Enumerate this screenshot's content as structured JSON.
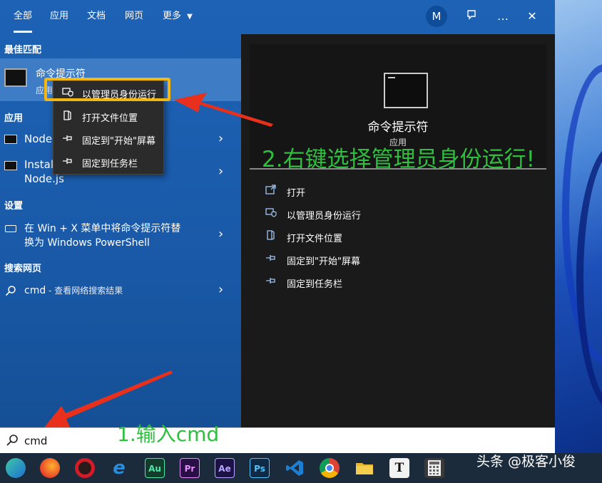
{
  "tabs": [
    {
      "label": "全部",
      "active": true
    },
    {
      "label": "应用",
      "active": false
    },
    {
      "label": "文档",
      "active": false
    },
    {
      "label": "网页",
      "active": false
    },
    {
      "label": "更多",
      "active": false
    }
  ],
  "account": {
    "initial": "M"
  },
  "top_icons": {
    "feedback": "feedback-icon",
    "more": "…",
    "close": "✕"
  },
  "sections": {
    "best_match": "最佳匹配",
    "apps": "应用",
    "settings": "设置",
    "web": "搜索网页"
  },
  "best_match": {
    "title": "命令提示符",
    "subtitle": "应用"
  },
  "apps": [
    {
      "label": "Node"
    },
    {
      "label_line1": "Instal",
      "label_line2": "Node.js"
    }
  ],
  "settings_item": {
    "line1": "在 Win + X 菜单中将命令提示符替",
    "line2": "换为 Windows PowerShell"
  },
  "web_item": {
    "query": "cmd",
    "suffix": " - 查看网络搜索结果"
  },
  "context_menu": [
    {
      "icon": "shield-run-icon",
      "label": "以管理员身份运行"
    },
    {
      "icon": "folder-location-icon",
      "label": "打开文件位置"
    },
    {
      "icon": "pin-start-icon",
      "label": "固定到\"开始\"屏幕"
    },
    {
      "icon": "pin-taskbar-icon",
      "label": "固定到任务栏"
    }
  ],
  "detail": {
    "title": "命令提示符",
    "subtitle": "应用",
    "actions": [
      {
        "icon": "open-icon",
        "label": "打开"
      },
      {
        "icon": "shield-run-icon",
        "label": "以管理员身份运行"
      },
      {
        "icon": "folder-location-icon",
        "label": "打开文件位置"
      },
      {
        "icon": "pin-start-icon",
        "label": "固定到\"开始\"屏幕"
      },
      {
        "icon": "pin-taskbar-icon",
        "label": "固定到任务栏"
      }
    ]
  },
  "search": {
    "value": "cmd"
  },
  "annotations": {
    "step1": "1.输入cmd",
    "step2": "2.右键选择管理员身份运行!"
  },
  "taskbar_apps": [
    {
      "name": "edge",
      "label": "",
      "color": "#1f8ad8"
    },
    {
      "name": "firefox",
      "label": "",
      "color": "#e8622a"
    },
    {
      "name": "opera",
      "label": "",
      "color": "#d31b2a"
    },
    {
      "name": "ie",
      "label": "e",
      "color": "#2a8bd8"
    },
    {
      "name": "audition",
      "label": "Au",
      "color": "#123c2c"
    },
    {
      "name": "premiere",
      "label": "Pr",
      "color": "#2a0f47"
    },
    {
      "name": "after-effects",
      "label": "Ae",
      "color": "#1d1245"
    },
    {
      "name": "photoshop",
      "label": "Ps",
      "color": "#0f2a44"
    },
    {
      "name": "vscode",
      "label": "",
      "color": "#1d7fd1"
    },
    {
      "name": "chrome",
      "label": "",
      "color": "#e0b020"
    },
    {
      "name": "explorer",
      "label": "",
      "color": "#e8b730"
    },
    {
      "name": "typora",
      "label": "T",
      "color": "#f2f2f2"
    },
    {
      "name": "calculator",
      "label": "",
      "color": "#3a3a3a"
    }
  ],
  "watermark": "头条 @极客小俊",
  "colors": {
    "highlight": "#f3b715",
    "annotation": "#2fbf3e",
    "arrow": "#e8301c"
  }
}
